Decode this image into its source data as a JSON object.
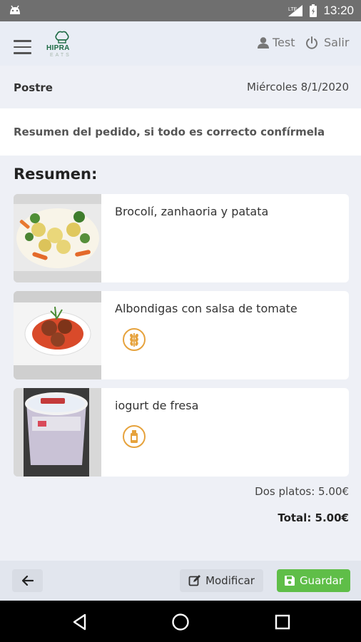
{
  "status_bar": {
    "time": "13:20",
    "network": "LTE"
  },
  "header": {
    "logo_text": "HIPRA",
    "logo_sub": "EATS",
    "user_name": "Test",
    "logout_label": "Salir"
  },
  "info": {
    "course": "Postre",
    "date": "Miércoles 8/1/2020"
  },
  "notice": "Resumen del pedido, si todo es correcto confírmela",
  "summary_title": "Resumen:",
  "items": [
    {
      "name": "Brocolí, zanhaoria y patata",
      "badge_icon": ""
    },
    {
      "name": "Albondigas con salsa de tomate",
      "badge_icon": "wheat-icon"
    },
    {
      "name": "iogurt de fresa",
      "badge_icon": "milk-icon"
    }
  ],
  "totals": {
    "subtotal": "Dos platos: 5.00€",
    "total": "Total: 5.00€"
  },
  "footer": {
    "modify_label": "Modificar",
    "save_label": "Guardar"
  },
  "colors": {
    "accent_green": "#5fbe48",
    "allergen_orange": "#e6a23c",
    "logo_green": "#1d6a44"
  }
}
